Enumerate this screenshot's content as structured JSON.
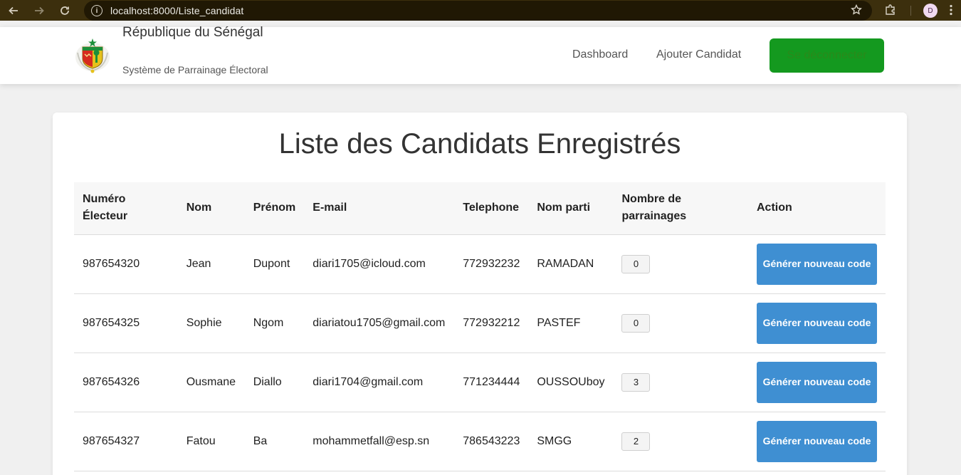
{
  "browser": {
    "url": "localhost:8000/Liste_candidat",
    "profile_initial": "D"
  },
  "header": {
    "country": "République du Sénégal",
    "system": "Système de Parrainage Électoral",
    "nav": {
      "dashboard": "Dashboard",
      "add_candidate": "Ajouter Candidat",
      "logout": "Se déconnecter"
    }
  },
  "main": {
    "title": "Liste des Candidats Enregistrés",
    "columns": {
      "numero": "Numéro Électeur",
      "nom": "Nom",
      "prenom": "Prénom",
      "email": "E-mail",
      "telephone": "Telephone",
      "parti": "Nom parti",
      "parrainages": "Nombre de parrainages",
      "action": "Action"
    },
    "rows": [
      {
        "numero": "987654320",
        "nom": "Jean",
        "prenom": "Dupont",
        "email": "diari1705@icloud.com",
        "telephone": "772932232",
        "parti": "RAMADAN",
        "parrainages": "0",
        "action": "Générer nouveau code"
      },
      {
        "numero": "987654325",
        "nom": "Sophie",
        "prenom": "Ngom",
        "email": "diariatou1705@gmail.com",
        "telephone": "772932212",
        "parti": "PASTEF",
        "parrainages": "0",
        "action": "Générer nouveau code"
      },
      {
        "numero": "987654326",
        "nom": "Ousmane",
        "prenom": "Diallo",
        "email": "diari1704@gmail.com",
        "telephone": "771234444",
        "parti": "OUSSOUboy",
        "parrainages": "3",
        "action": "Générer nouveau code"
      },
      {
        "numero": "987654327",
        "nom": "Fatou",
        "prenom": "Ba",
        "email": "mohammetfall@esp.sn",
        "telephone": "786543223",
        "parti": "SMGG",
        "parrainages": "2",
        "action": "Générer nouveau code"
      }
    ]
  },
  "colors": {
    "logout_bg": "#14991f",
    "action_button": "#3f8fd2",
    "browser_frame": "#3c2f0d"
  }
}
